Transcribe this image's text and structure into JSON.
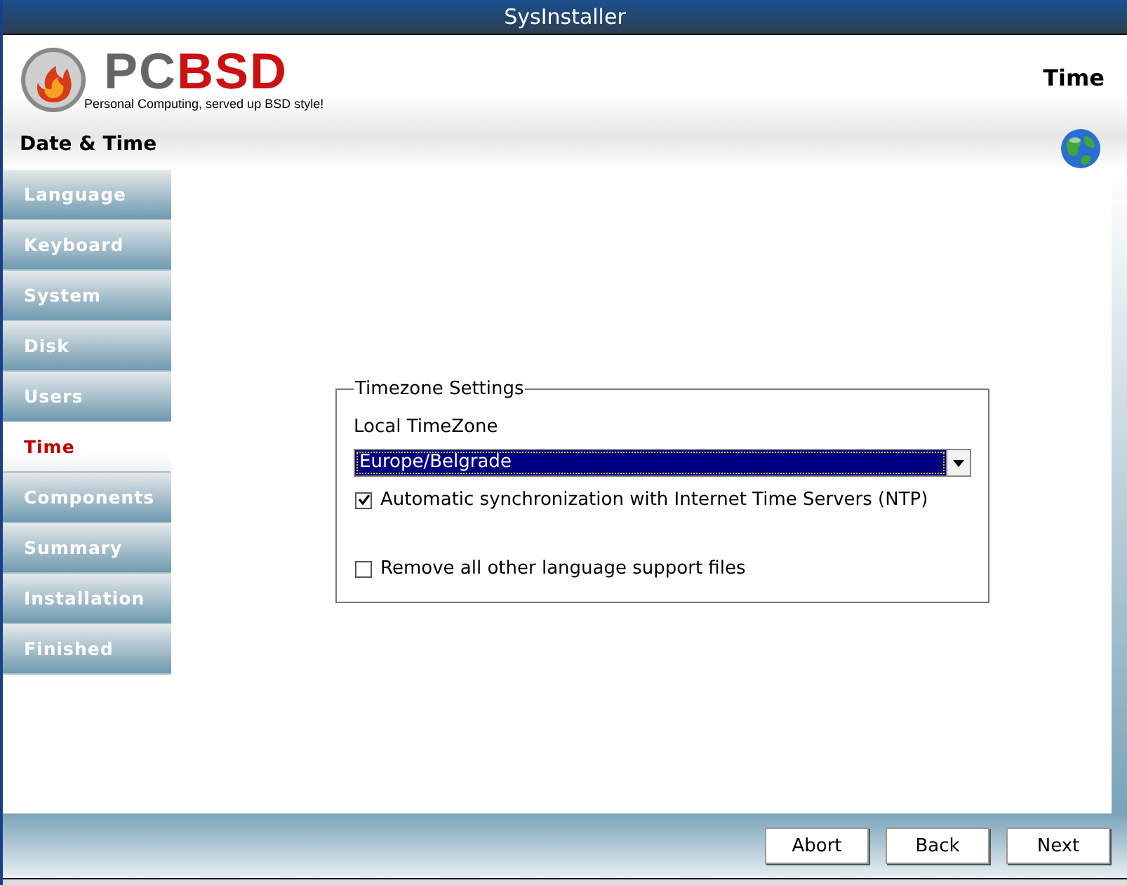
{
  "window": {
    "title": "SysInstaller"
  },
  "header": {
    "logo_left": "PC",
    "logo_right": "BSD",
    "tagline": "Personal Computing, served up BSD style!",
    "page_title": "Time",
    "section_title": "Date & Time"
  },
  "sidebar": {
    "items": [
      {
        "label": "Language",
        "selected": false
      },
      {
        "label": "Keyboard",
        "selected": false
      },
      {
        "label": "System",
        "selected": false
      },
      {
        "label": "Disk",
        "selected": false
      },
      {
        "label": "Users",
        "selected": false
      },
      {
        "label": "Time",
        "selected": true
      },
      {
        "label": "Components",
        "selected": false
      },
      {
        "label": "Summary",
        "selected": false
      },
      {
        "label": "Installation",
        "selected": false
      },
      {
        "label": "Finished",
        "selected": false
      }
    ]
  },
  "timezone_settings": {
    "title": "Timezone Settings",
    "label": "Local TimeZone",
    "value": "Europe/Belgrade",
    "options": [
      {
        "label": "Automatic synchronization with Internet Time Servers (NTP)",
        "checked": true
      },
      {
        "label": "Remove all other language support files",
        "checked": false
      }
    ]
  },
  "buttons": [
    "Abort",
    "Back",
    "Next"
  ]
}
